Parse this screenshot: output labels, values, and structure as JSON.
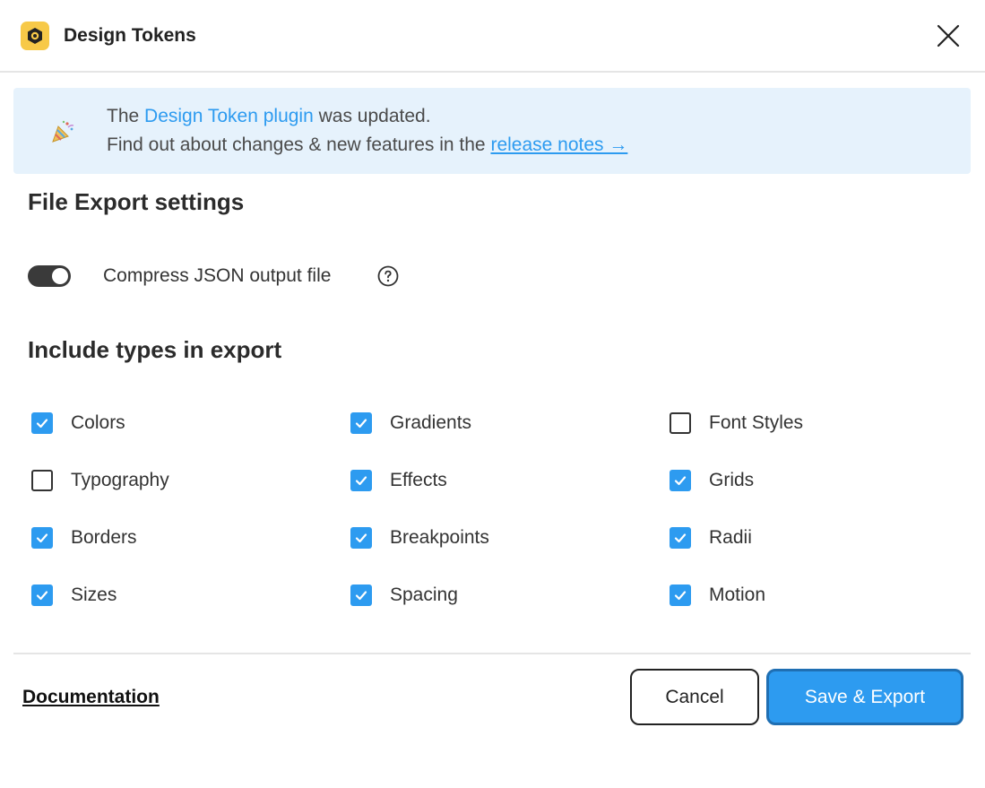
{
  "window": {
    "title": "Design Tokens",
    "app_icon": "design-tokens-logo-icon",
    "close_icon": "close-icon"
  },
  "banner": {
    "icon": "party-popper-icon",
    "line1_prefix": "The ",
    "line1_link": "Design Token plugin",
    "line1_suffix": " was updated.",
    "line2_prefix": "Find out about changes & new features in the ",
    "line2_link": "release notes →"
  },
  "file_export": {
    "title": "File Export settings",
    "compress_label": "Compress JSON output file",
    "compress_enabled": true,
    "help_icon": "help-circle-icon"
  },
  "types": {
    "title": "Include types in export",
    "items": [
      {
        "label": "Colors",
        "checked": true
      },
      {
        "label": "Gradients",
        "checked": true
      },
      {
        "label": "Font Styles",
        "checked": false
      },
      {
        "label": "Typography",
        "checked": false
      },
      {
        "label": "Effects",
        "checked": true
      },
      {
        "label": "Grids",
        "checked": true
      },
      {
        "label": "Borders",
        "checked": true
      },
      {
        "label": "Breakpoints",
        "checked": true
      },
      {
        "label": "Radii",
        "checked": true
      },
      {
        "label": "Sizes",
        "checked": true
      },
      {
        "label": "Spacing",
        "checked": true
      },
      {
        "label": "Motion",
        "checked": true
      }
    ]
  },
  "footer": {
    "documentation": "Documentation",
    "cancel": "Cancel",
    "save": "Save & Export"
  },
  "colors": {
    "accent": "#2d9bf0",
    "banner_bg": "#e6f2fc",
    "logo_bg": "#f7c948",
    "toggle_on": "#3a3a3a"
  }
}
